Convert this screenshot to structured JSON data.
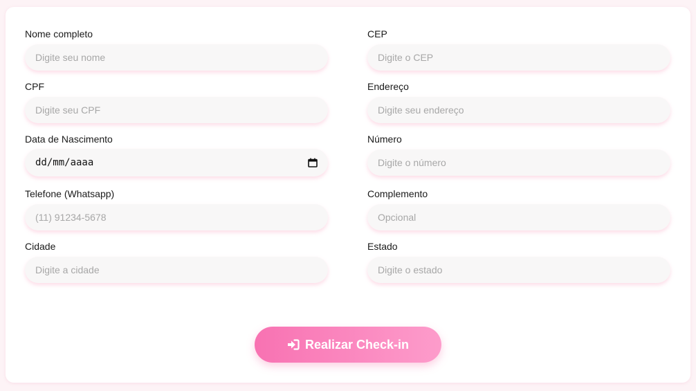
{
  "form": {
    "left": [
      {
        "label": "Nome completo",
        "placeholder": "Digite seu nome"
      },
      {
        "label": "CPF",
        "placeholder": "Digite seu CPF"
      },
      {
        "label": "Data de Nascimento",
        "value": "dd/mm/aaaa"
      },
      {
        "label": "Telefone (Whatsapp)",
        "placeholder": "(11) 91234-5678"
      },
      {
        "label": "Cidade",
        "placeholder": "Digite a cidade"
      }
    ],
    "right": [
      {
        "label": "CEP",
        "placeholder": "Digite o CEP"
      },
      {
        "label": "Endereço",
        "placeholder": "Digite seu endereço"
      },
      {
        "label": "Número",
        "placeholder": "Digite o número"
      },
      {
        "label": "Complemento",
        "placeholder": "Opcional"
      },
      {
        "label": "Estado",
        "placeholder": "Digite o estado"
      }
    ]
  },
  "submit": {
    "label": "Realizar Check-in",
    "icon": "sign-in-icon"
  },
  "colors": {
    "accent_start": "#f872b2",
    "accent_end": "#fd9ccb",
    "input_bg": "#f8f7f7",
    "page_bg": "#fdf3f6"
  }
}
